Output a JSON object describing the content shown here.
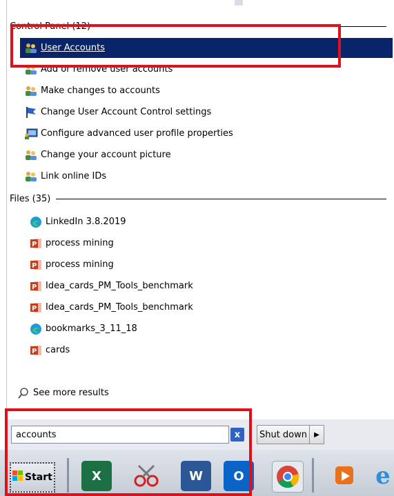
{
  "control_panel": {
    "header": "Control Panel (12)",
    "items": [
      {
        "label": "User Accounts",
        "icon": "users-icon",
        "selected": true
      },
      {
        "label": "Add or remove user accounts",
        "icon": "users-icon"
      },
      {
        "label": "Make changes to accounts",
        "icon": "users-icon"
      },
      {
        "label": "Change User Account Control settings",
        "icon": "uac-flag-icon"
      },
      {
        "label": "Configure advanced user profile properties",
        "icon": "monitor-users-icon"
      },
      {
        "label": "Change your account picture",
        "icon": "users-icon"
      },
      {
        "label": "Link online IDs",
        "icon": "users-icon"
      }
    ]
  },
  "files": {
    "header": "Files (35)",
    "items": [
      {
        "label": "LinkedIn 3.8.2019",
        "icon": "edge-icon"
      },
      {
        "label": "process mining",
        "icon": "powerpoint-icon"
      },
      {
        "label": "process mining",
        "icon": "powerpoint-icon"
      },
      {
        "label": "Idea_cards_PM_Tools_benchmark",
        "icon": "powerpoint-icon"
      },
      {
        "label": "Idea_cards_PM_Tools_benchmark",
        "icon": "powerpoint-icon"
      },
      {
        "label": "bookmarks_3_11_18",
        "icon": "edge-icon"
      },
      {
        "label": "cards",
        "icon": "powerpoint-icon"
      }
    ]
  },
  "see_more": "See more results",
  "search": {
    "value": "accounts",
    "clear_icon": "x"
  },
  "shutdown": {
    "label": "Shut down",
    "arrow": "▶"
  },
  "taskbar": {
    "start_label": "Start",
    "apps": [
      {
        "name": "excel-icon",
        "glyph": "X",
        "color": "#1d7044"
      },
      {
        "name": "snipping-tool-icon",
        "glyph": "",
        "color": ""
      },
      {
        "name": "word-icon",
        "glyph": "W",
        "color": "#2b5797"
      },
      {
        "name": "outlook-icon",
        "glyph": "O",
        "color": "#0a64c8"
      },
      {
        "name": "chrome-icon",
        "glyph": "",
        "color": ""
      },
      {
        "name": "media-player-icon",
        "glyph": "",
        "color": "#e8711c"
      },
      {
        "name": "ie-icon",
        "glyph": "e",
        "color": "#2f8fd8"
      }
    ]
  },
  "colors": {
    "selection": "#0a246a",
    "highlight_box": "#e0101a"
  }
}
